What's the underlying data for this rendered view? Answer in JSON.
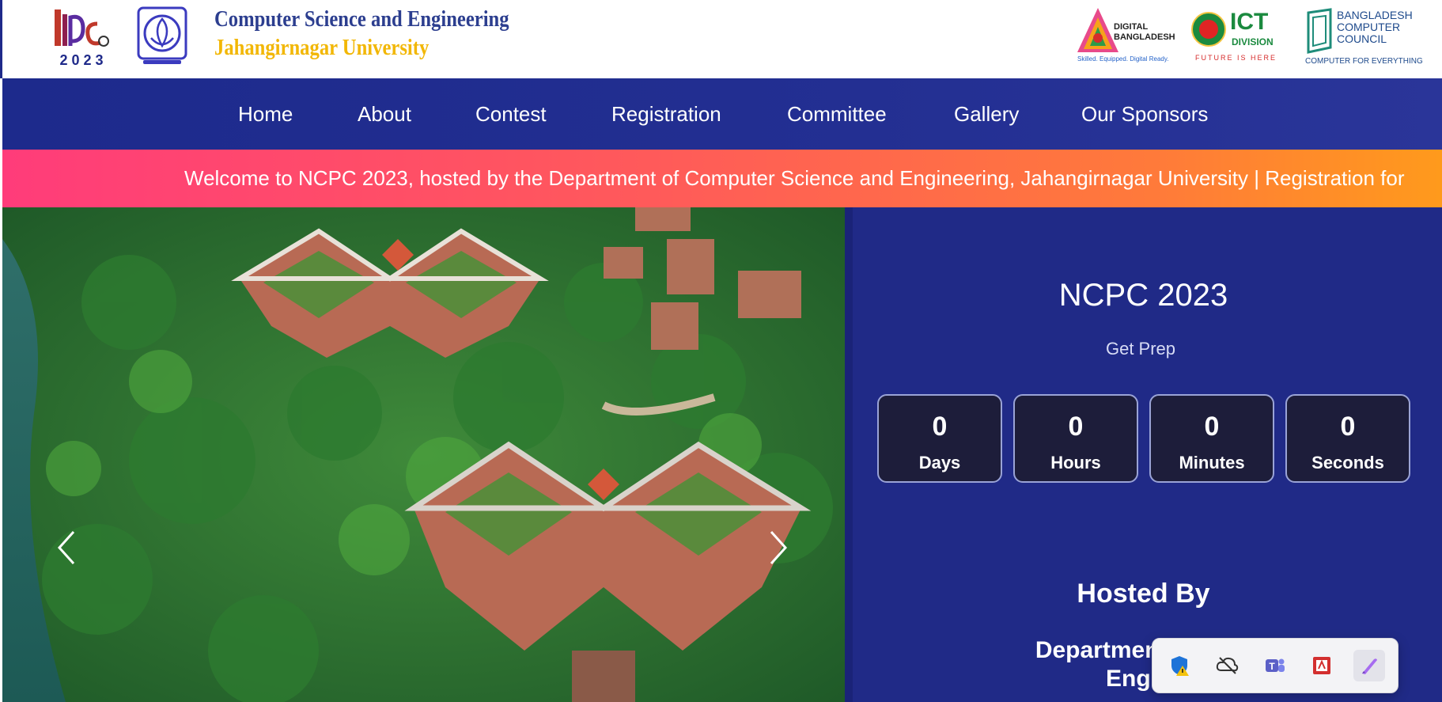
{
  "header": {
    "ncpc_logo_text": "NCPC",
    "ncpc_logo_year": "2 0 2 3",
    "title": "Computer Science and Engineering",
    "subtitle": "Jahangirnagar University",
    "partners": {
      "digital_bangladesh": {
        "line1": "DIGITAL",
        "line2": "BANGLADESH",
        "tagline": "Skilled. Equipped. Digital Ready."
      },
      "ict_division": {
        "name": "ICT",
        "line2": "DIVISION",
        "tagline": "FUTURE IS HERE"
      },
      "bcc": {
        "line1": "BANGLADESH",
        "line2": "COMPUTER",
        "line3": "COUNCIL",
        "tagline": "COMPUTER FOR EVERYTHING"
      }
    }
  },
  "nav": {
    "items": [
      "Home",
      "About",
      "Contest",
      "Registration",
      "Committee",
      "Gallery",
      "Our Sponsors"
    ]
  },
  "marquee": {
    "text": "Welcome to NCPC 2023, hosted by the Department of Computer Science and Engineering, Jahangirnagar University | Registration for"
  },
  "panel": {
    "title": "NCPC 2023",
    "subtitle": "Get Prep",
    "countdown": [
      {
        "value": "0",
        "label": "Days"
      },
      {
        "value": "0",
        "label": "Hours"
      },
      {
        "value": "0",
        "label": "Minutes"
      },
      {
        "value": "0",
        "label": "Seconds"
      }
    ],
    "hosted_title": "Hosted By",
    "hosted_line1": "Department of Com",
    "hosted_line2": "Engine"
  },
  "tray": {
    "icons": [
      "windows-security-icon",
      "onedrive-icon",
      "teams-icon",
      "pdf-reader-icon",
      "pen-icon"
    ]
  },
  "colors": {
    "nav_bg": "#1d2a8c",
    "panel_bg": "#202a87",
    "marquee_start": "#ff3c7a",
    "marquee_end": "#ff9a1c",
    "title_blue": "#2c3e8f",
    "title_gold": "#f2b705"
  }
}
